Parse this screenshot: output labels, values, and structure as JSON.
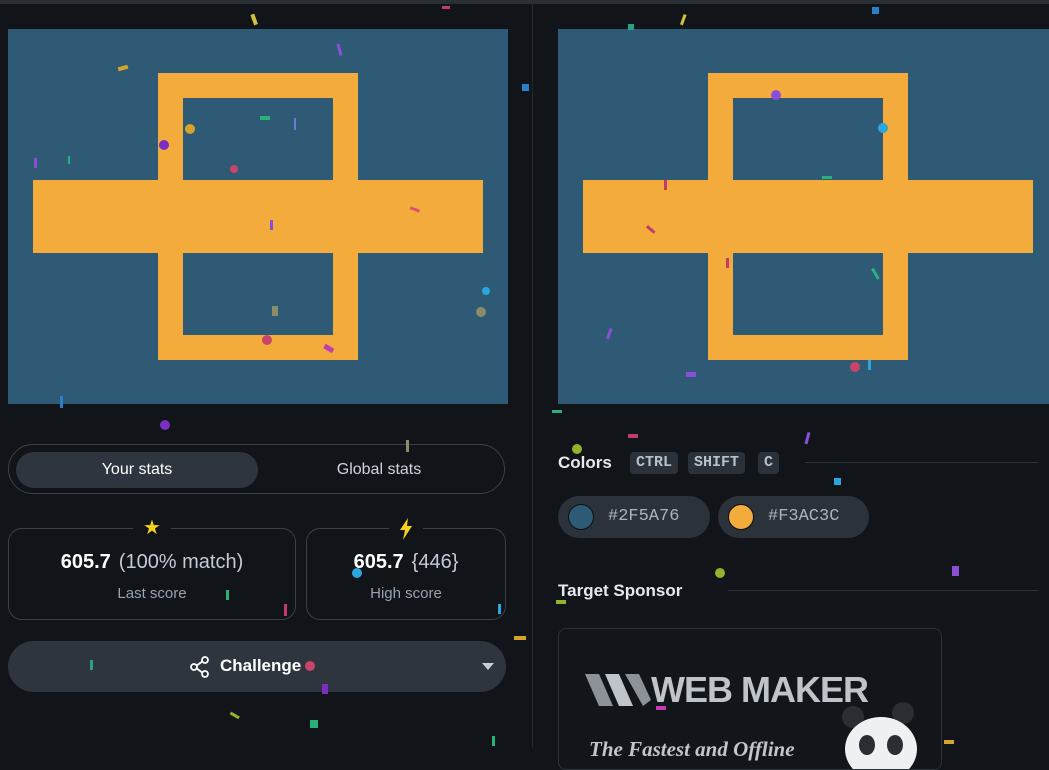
{
  "target": {
    "colors": {
      "background": "#2F5A76",
      "shape": "#F3AC3C"
    }
  },
  "tabs": {
    "your_stats": "Your stats",
    "global_stats": "Global stats"
  },
  "stats": {
    "last": {
      "icon": "star-icon",
      "score": "605.7",
      "match": "(100% match)",
      "label": "Last score"
    },
    "high": {
      "icon": "lightning-icon",
      "score": "605.7",
      "chars": "{446}",
      "label": "High score"
    }
  },
  "challenge": {
    "label": "Challenge"
  },
  "colors_section": {
    "title": "Colors",
    "shortcut": [
      "CTRL",
      "SHIFT",
      "C"
    ],
    "swatches": [
      {
        "hex": "#2F5A76",
        "color": "#2F5A76"
      },
      {
        "hex": "#F3AC3C",
        "color": "#F3AC3C"
      }
    ]
  },
  "sponsor": {
    "title": "Target Sponsor",
    "brand": "WEB MAKER",
    "tagline": "The Fastest and Offline"
  }
}
